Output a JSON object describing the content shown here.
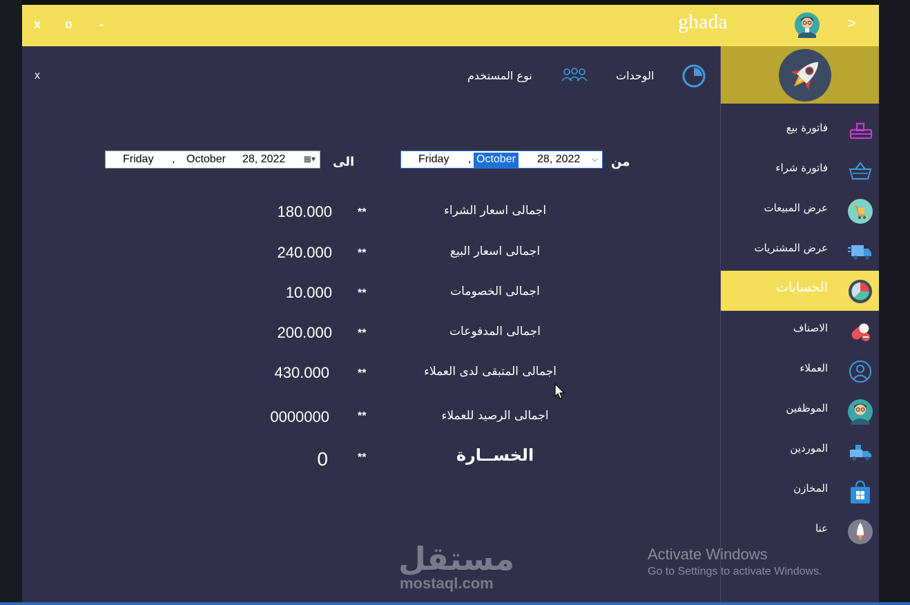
{
  "titlebar": {
    "close": "x",
    "maximize": "o",
    "minimize": "-",
    "username": "ghada",
    "next": ">",
    "color": "#f3df5a"
  },
  "toolbar": {
    "close": "x",
    "units_label": "الوحدات",
    "user_type_label": "نوع المستخدم"
  },
  "date_range": {
    "from_label": "من",
    "to_label": "الى",
    "from": {
      "weekday": "Friday",
      "sep": ",",
      "month": "October",
      "daydate": "28, 2022",
      "dropdown": "⌵"
    },
    "to": {
      "weekday": "Friday",
      "sep": ",",
      "month": "October",
      "daydate": "28, 2022",
      "dropdown": "▦▾"
    }
  },
  "summary": [
    {
      "label": "اجمالى اسعار الشراء",
      "sep": "**",
      "value": "180.000"
    },
    {
      "label": "اجمالى اسعار البيع",
      "sep": "**",
      "value": "240.000"
    },
    {
      "label": "اجمالى الخصومات",
      "sep": "**",
      "value": "10.000"
    },
    {
      "label": "اجمالى المدفوعات",
      "sep": "**",
      "value": "200.000"
    },
    {
      "label": "اجمالى المتبقى لدى العملاء",
      "sep": "**",
      "value": "430.000"
    },
    {
      "label": "اجمالى الرصيد للعملاء",
      "sep": "**",
      "value": "0000000"
    },
    {
      "label": "الخســارة",
      "sep": "**",
      "value": "0"
    }
  ],
  "sidebar": {
    "active_color": "#f3df5a",
    "items": [
      {
        "label": "فاتورة بيع",
        "icon": "cash-register-icon"
      },
      {
        "label": "فاتورة شراء",
        "icon": "basket-icon"
      },
      {
        "label": "عرض المبيعات",
        "icon": "shopping-cart-icon"
      },
      {
        "label": "عرض المشتريات",
        "icon": "delivery-truck-icon"
      },
      {
        "label": "الحسابات",
        "icon": "pie-chart-icon",
        "active": true
      },
      {
        "label": "الاصناف",
        "icon": "pill-icon"
      },
      {
        "label": "العملاء",
        "icon": "user-circle-icon"
      },
      {
        "label": "الموظفين",
        "icon": "employee-avatar-icon"
      },
      {
        "label": "الموردين",
        "icon": "supplier-truck-icon"
      },
      {
        "label": "المخازن",
        "icon": "store-bag-icon"
      },
      {
        "label": "عنا",
        "icon": "rocket-about-icon"
      }
    ]
  },
  "watermark": {
    "arabic": "مستقل",
    "latin": "mostaql.com"
  },
  "os_notice": {
    "title": "Activate Windows",
    "subtitle": "Go to Settings to activate Windows."
  }
}
